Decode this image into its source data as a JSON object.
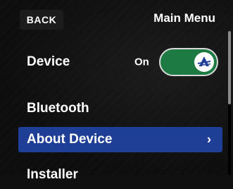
{
  "header": {
    "back_label": "BACK",
    "title": "Main Menu"
  },
  "menu": {
    "device": {
      "label": "Device",
      "state": "On",
      "toggle_on": true,
      "toggle_color": "#1e7a43"
    },
    "bluetooth": {
      "label": "Bluetooth"
    },
    "about": {
      "label": "About Device",
      "chevron": "›",
      "highlight_color": "#1f3f96"
    },
    "installer": {
      "label": "Installer"
    }
  },
  "icons": {
    "toggle_knob": "brand-logo-icon",
    "chevron": "chevron-right-icon"
  }
}
